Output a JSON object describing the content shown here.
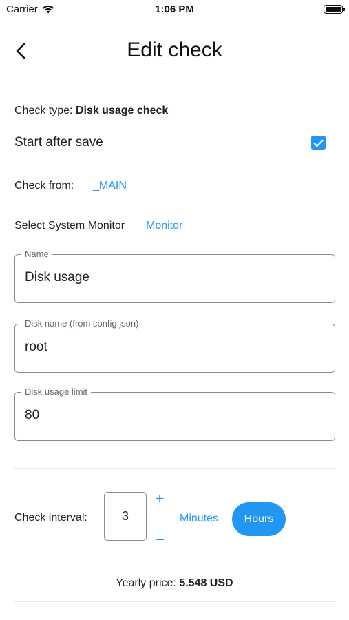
{
  "status_bar": {
    "carrier": "Carrier",
    "time": "1:06 PM"
  },
  "header": {
    "title": "Edit check"
  },
  "check_type": {
    "label": "Check type:",
    "value": "Disk usage check"
  },
  "start_after_save": {
    "label": "Start after save",
    "checked": true
  },
  "check_from": {
    "label": "Check from:",
    "value": "_MAIN"
  },
  "system_monitor": {
    "label": "Select System Monitor",
    "value": "Monitor"
  },
  "fields": [
    {
      "label": "Name",
      "value": "Disk usage"
    },
    {
      "label": "Disk name (from config.json)",
      "value": "root"
    },
    {
      "label": "Disk usage limit",
      "value": "80"
    }
  ],
  "interval": {
    "label": "Check interval:",
    "value": "3",
    "increment": "+",
    "decrement": "–",
    "units": [
      "Minutes",
      "Hours"
    ],
    "selected_unit": "Hours"
  },
  "price": {
    "label": "Yearly price:",
    "value": "5.548 USD"
  },
  "colors": {
    "accent": "#2196f3",
    "border": "#8c8c8c"
  },
  "icons": [
    "wifi-icon",
    "battery-icon",
    "back-arrow-icon",
    "checkmark-icon"
  ]
}
